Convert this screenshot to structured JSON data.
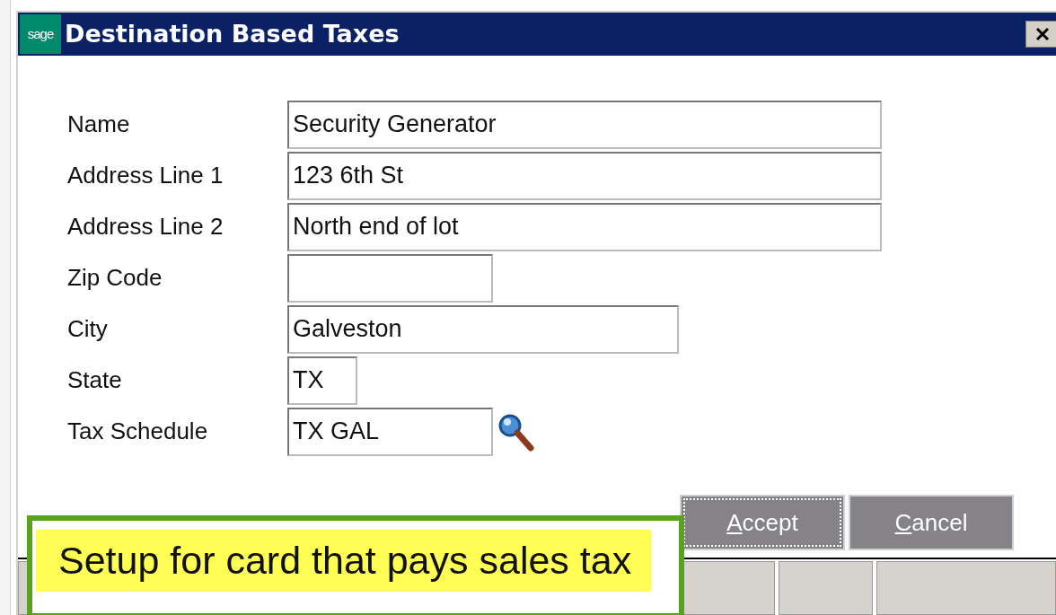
{
  "window": {
    "title": "Destination Based Taxes",
    "logo": "sage"
  },
  "fields": [
    {
      "label": "Name",
      "value": "Security Generator",
      "lookup": false
    },
    {
      "label": "Address Line 1",
      "value": "123 6th St",
      "lookup": false
    },
    {
      "label": "Address Line 2",
      "value": "North end of lot",
      "lookup": false
    },
    {
      "label": "Zip Code",
      "lookup": false
    },
    {
      "label": "City",
      "value": "Galveston",
      "lookup": false
    },
    {
      "label": "State",
      "value": "TX",
      "lookup": false
    },
    {
      "label": "Tax Schedule",
      "value": "TX GAL",
      "lookup": true
    }
  ],
  "buttons": [
    {
      "label": "Accept",
      "focused": true
    },
    {
      "label": "Cancel",
      "focused": false
    }
  ],
  "callout": {
    "text": "Setup for card that pays sales tax"
  }
}
